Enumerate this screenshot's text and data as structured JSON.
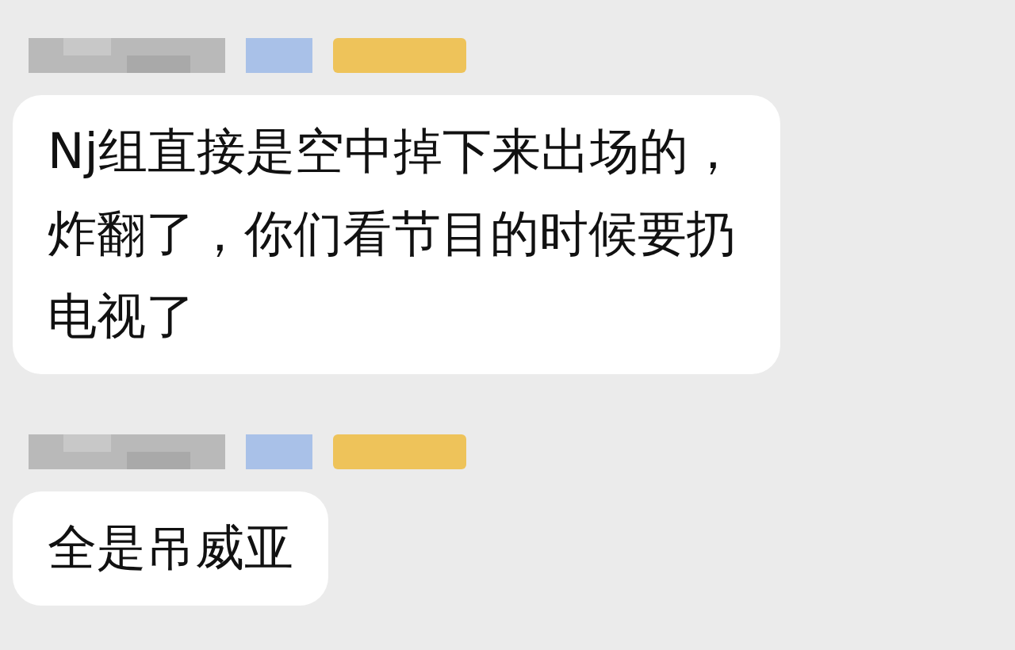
{
  "messages": [
    {
      "text": "Nj组直接是空中掉下来出场的，炸翻了，你们看节目的时候要扔电视了"
    },
    {
      "text": "全是吊威亚"
    }
  ]
}
